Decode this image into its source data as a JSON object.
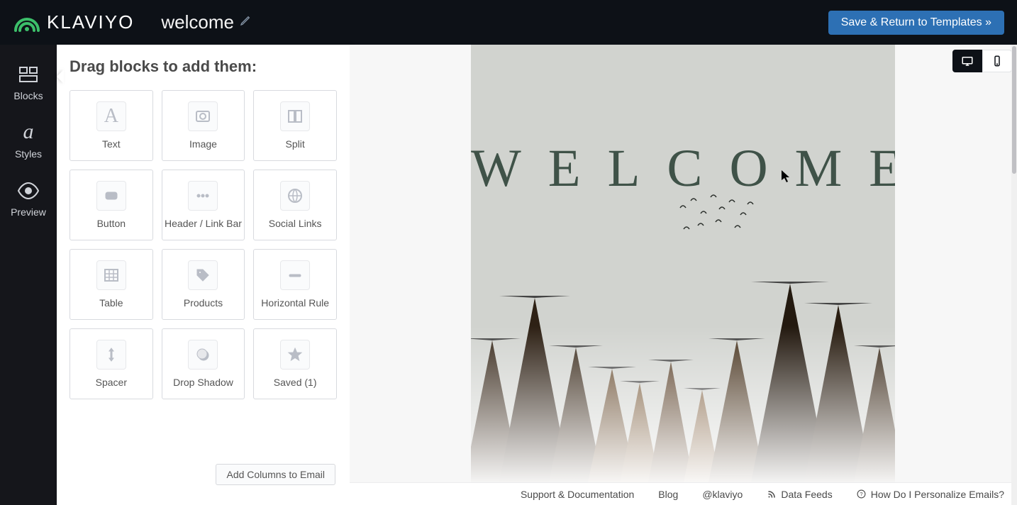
{
  "header": {
    "brand": "KLAVIYO",
    "title": "welcome",
    "save_label": "Save & Return to Templates »"
  },
  "left_nav": {
    "blocks": "Blocks",
    "styles": "Styles",
    "preview": "Preview"
  },
  "panel": {
    "heading": "Drag blocks to add them:",
    "add_columns": "Add Columns to Email"
  },
  "blocks": {
    "text": "Text",
    "image": "Image",
    "split": "Split",
    "button": "Button",
    "header_link_bar": "Header / Link Bar",
    "social_links": "Social Links",
    "table": "Table",
    "products": "Products",
    "horizontal_rule": "Horizontal Rule",
    "spacer": "Spacer",
    "drop_shadow": "Drop Shadow",
    "saved": "Saved (1)"
  },
  "canvas": {
    "hero_text": "WELCOME"
  },
  "footer": {
    "support": "Support & Documentation",
    "blog": "Blog",
    "twitter": "@klaviyo",
    "data_feeds": "Data Feeds",
    "personalize": "How Do I Personalize Emails?"
  }
}
